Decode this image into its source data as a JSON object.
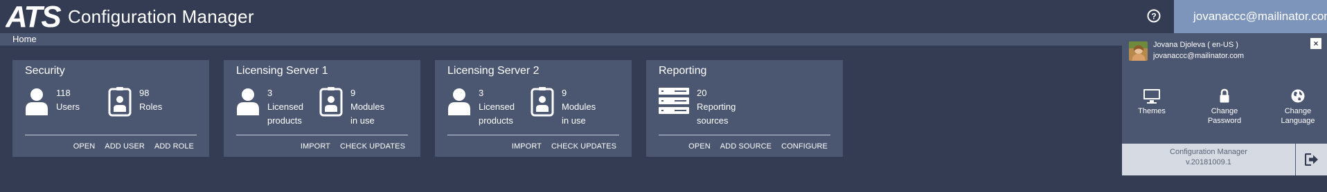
{
  "header": {
    "logo_text": "ATS",
    "app_title": "Configuration Manager",
    "user_email": "jovanaccc@mailinator.com"
  },
  "breadcrumb": {
    "home": "Home"
  },
  "cards": [
    {
      "title": "Security",
      "stats": [
        {
          "icon": "user-icon",
          "lines": [
            "118",
            "Users"
          ]
        },
        {
          "icon": "badge-icon",
          "lines": [
            "98",
            "Roles"
          ]
        }
      ],
      "actions": [
        "OPEN",
        "ADD USER",
        "ADD ROLE"
      ]
    },
    {
      "title": "Licensing Server 1",
      "stats": [
        {
          "icon": "user-icon",
          "lines": [
            "3",
            "Licensed",
            "products"
          ]
        },
        {
          "icon": "badge-icon",
          "lines": [
            "9",
            "Modules",
            "in use"
          ]
        }
      ],
      "actions": [
        "IMPORT",
        "CHECK UPDATES"
      ]
    },
    {
      "title": "Licensing Server 2",
      "stats": [
        {
          "icon": "user-icon",
          "lines": [
            "3",
            "Licensed",
            "products"
          ]
        },
        {
          "icon": "badge-icon",
          "lines": [
            "9",
            "Modules",
            "in use"
          ]
        }
      ],
      "actions": [
        "IMPORT",
        "CHECK UPDATES"
      ]
    },
    {
      "title": "Reporting",
      "stats": [
        {
          "icon": "server-icon",
          "lines": [
            "20",
            "Reporting",
            "sources"
          ]
        }
      ],
      "actions": [
        "OPEN",
        "ADD SOURCE",
        "CONFIGURE"
      ]
    }
  ],
  "user_panel": {
    "name": "Jovana Djoleva ( en-US )",
    "email": "jovanaccc@mailinator.com",
    "close_label": "×",
    "items": [
      {
        "icon": "monitor-icon",
        "label_lines": [
          "Themes"
        ]
      },
      {
        "icon": "lock-icon",
        "label_lines": [
          "Change",
          "Password"
        ]
      },
      {
        "icon": "globe-icon",
        "label_lines": [
          "Change",
          "Language"
        ]
      }
    ],
    "footer_app": "Configuration Manager",
    "footer_version": "v.20181009.1"
  },
  "colors": {
    "background": "#333c52",
    "card": "#4b5670",
    "user_button": "#7d95bb",
    "footer": "#d6dbe3"
  }
}
